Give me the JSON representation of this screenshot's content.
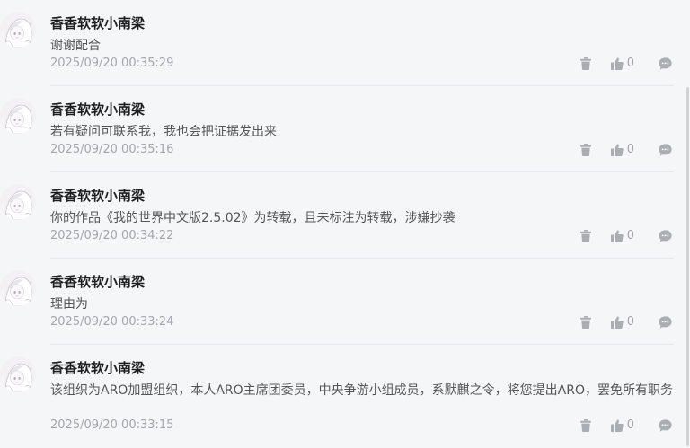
{
  "comments": [
    {
      "username": "香香软软小南梁",
      "content": "谢谢配合",
      "timestamp": "2025/09/20 00:35:29",
      "likes": "0"
    },
    {
      "username": "香香软软小南梁",
      "content": "若有疑问可联系我，我也会把证据发出来",
      "timestamp": "2025/09/20 00:35:16",
      "likes": "0"
    },
    {
      "username": "香香软软小南梁",
      "content": "你的作品《我的世界中文版2.5.02》为转载，且未标注为转载，涉嫌抄袭",
      "timestamp": "2025/09/20 00:34:22",
      "likes": "0"
    },
    {
      "username": "香香软软小南梁",
      "content": "理由为",
      "timestamp": "2025/09/20 00:33:24",
      "likes": "0"
    },
    {
      "username": "香香软软小南梁",
      "content": "该组织为ARO加盟组织，本人ARO主席团委员，中央争游小组成员，系默麒之令，将您提出ARO，罢免所有职务",
      "timestamp": "2025/09/20 00:33:15",
      "likes": "0"
    }
  ],
  "icons": {
    "delete": "trash-icon",
    "like": "thumbs-up-icon",
    "reply": "chat-bubble-icon"
  },
  "colors": {
    "background": "#f4f6f8",
    "username": "#1f1f1f",
    "content": "#555555",
    "meta": "#a2a7ad",
    "divider": "#e6e8eb"
  }
}
